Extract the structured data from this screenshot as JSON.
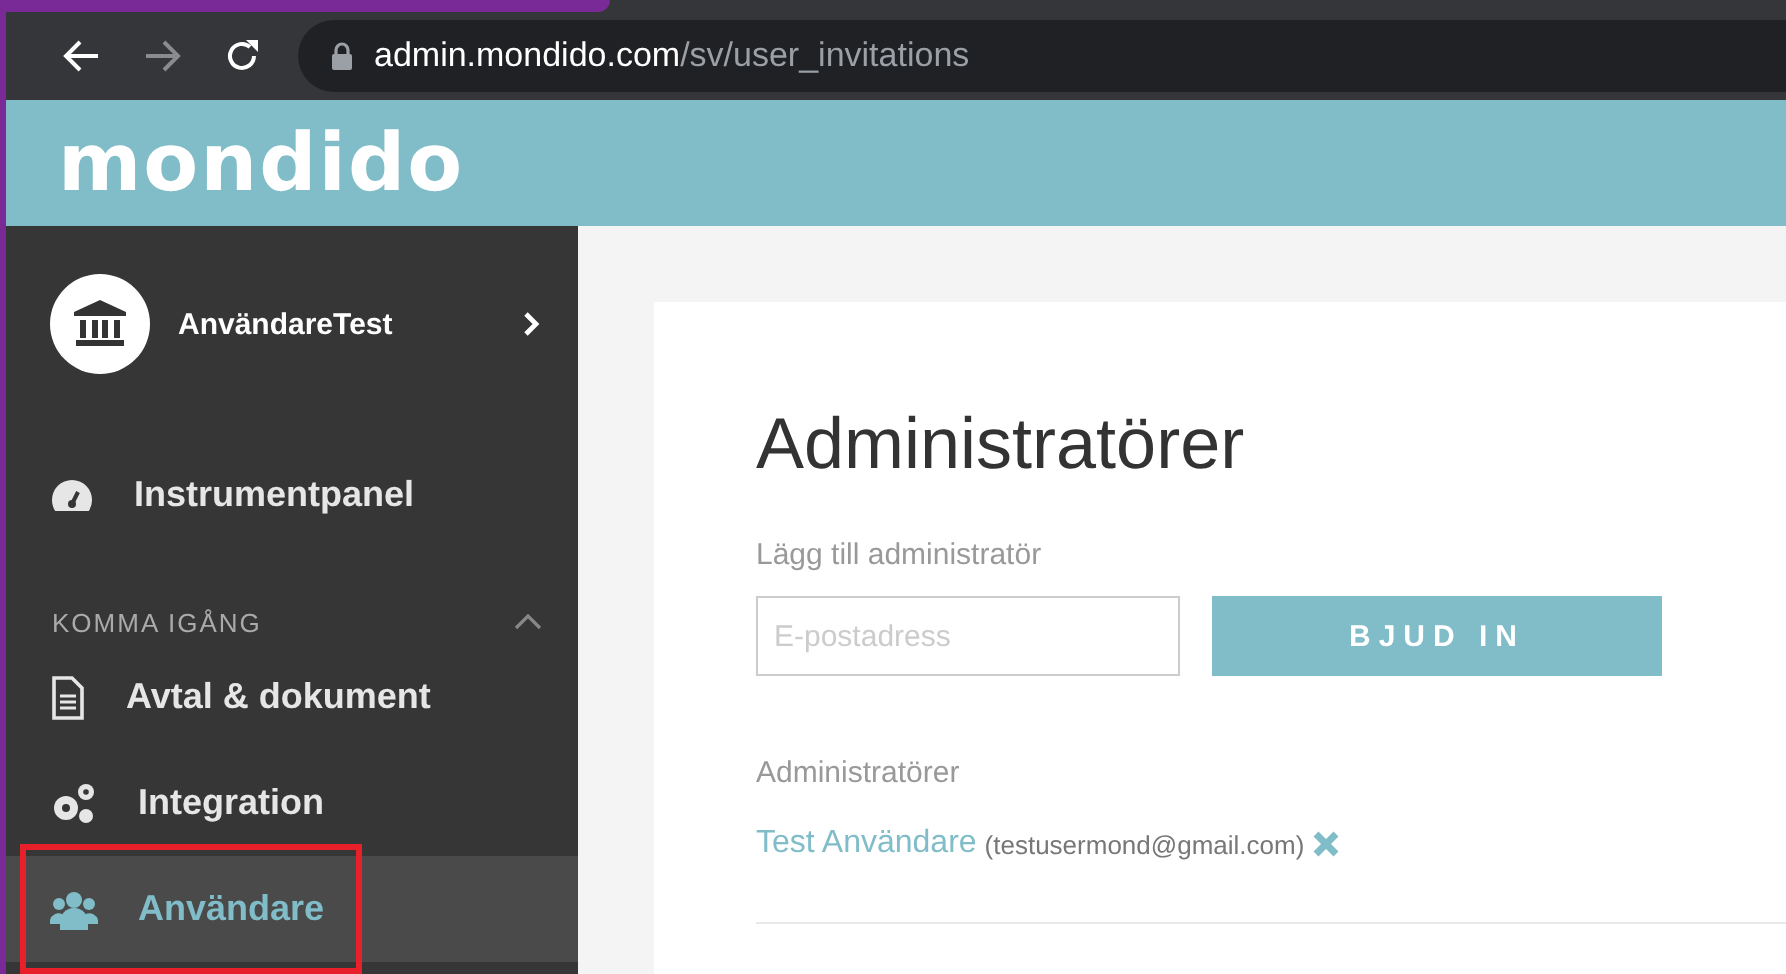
{
  "browser": {
    "url_host": "admin.mondido.com",
    "url_path": "/sv/user_invitations"
  },
  "header": {
    "logo": "mondido"
  },
  "sidebar": {
    "account": {
      "name": "AnvändareTest"
    },
    "items": [
      {
        "label": "Instrumentpanel",
        "selected": false
      }
    ],
    "sections": [
      {
        "title": "KOMMA IGÅNG",
        "expanded": true,
        "items": [
          {
            "label": "Avtal & dokument",
            "selected": false
          },
          {
            "label": "Integration",
            "selected": false
          },
          {
            "label": "Användare",
            "selected": true,
            "highlighted": true
          }
        ]
      }
    ]
  },
  "main": {
    "title": "Administratörer",
    "add_label": "Lägg till administratör",
    "email_field": {
      "placeholder": "E-postadress"
    },
    "invite_button": "BJUD IN",
    "list_title": "Administratörer",
    "admins": [
      {
        "name": "Test Användare",
        "email": "(testusermond@gmail.com)"
      }
    ]
  }
}
